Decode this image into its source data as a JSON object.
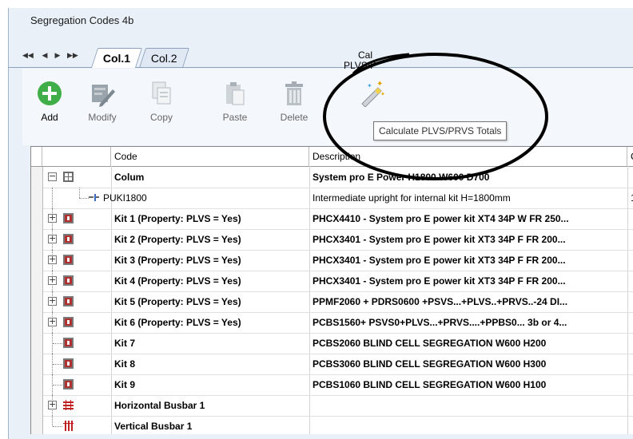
{
  "window": {
    "title": "Segregation Codes 4b"
  },
  "tabs": [
    {
      "label": "Col.1",
      "active": true
    },
    {
      "label": "Col.2",
      "active": false
    }
  ],
  "nav": {
    "first": "◀◀",
    "prev": "◀",
    "next": "▶",
    "last": "▶▶"
  },
  "toolbar": {
    "add": "Add",
    "modify": "Modify",
    "copy": "Copy",
    "paste": "Paste",
    "delete": "Delete",
    "calc_line1": "Cal",
    "calc_line2": "PLVS/P",
    "tooltip": "Calculate PLVS/PRVS Totals"
  },
  "grid": {
    "headers": {
      "code": "Code",
      "description": "Description",
      "extra": "C"
    },
    "rows": [
      {
        "code": "Colum",
        "description": "System pro E Power H1800 W600 D700",
        "bold": true,
        "extra": ""
      },
      {
        "code": "PUKI1800",
        "description": "Intermediate upright for internal kit H=1800mm",
        "bold": false,
        "extra": "1"
      },
      {
        "code": "Kit 1 (Property: PLVS = Yes)",
        "description": "PHCX4410 - System pro E power kit XT4 34P W FR 250...",
        "bold": true,
        "extra": ""
      },
      {
        "code": "Kit 2 (Property: PLVS = Yes)",
        "description": "PHCX3401 - System pro E power kit XT3 34P F FR 200...",
        "bold": true,
        "extra": ""
      },
      {
        "code": "Kit 3 (Property: PLVS = Yes)",
        "description": "PHCX3401 - System pro E power kit XT3 34P F FR 200...",
        "bold": true,
        "extra": ""
      },
      {
        "code": "Kit 4 (Property: PLVS = Yes)",
        "description": "PHCX3401 - System pro E power kit XT3 34P F FR 200...",
        "bold": true,
        "extra": ""
      },
      {
        "code": "Kit 5 (Property: PLVS = Yes)",
        "description": "PPMF2060 + PDRS0600 +PSVS...+PLVS..+PRVS..-24 DI...",
        "bold": true,
        "extra": ""
      },
      {
        "code": "Kit 6 (Property: PLVS = Yes)",
        "description": "PCBS1560+ PSVS0+PLVS...+PRVS....+PPBS0... 3b or 4...",
        "bold": true,
        "extra": ""
      },
      {
        "code": "Kit 7",
        "description": "PCBS2060 BLIND CELL SEGREGATION W600 H200",
        "bold": true,
        "extra": ""
      },
      {
        "code": "Kit 8",
        "description": "PCBS3060 BLIND CELL SEGREGATION W600 H300",
        "bold": true,
        "extra": ""
      },
      {
        "code": "Kit 9",
        "description": "PCBS1060 BLIND CELL SEGREGATION W600 H100",
        "bold": true,
        "extra": ""
      },
      {
        "code": "Horizontal Busbar 1",
        "description": "",
        "bold": true,
        "extra": ""
      },
      {
        "code": "Vertical Busbar 1",
        "description": "",
        "bold": true,
        "extra": ""
      }
    ],
    "expander_plus": "+",
    "expander_minus": "−"
  },
  "colors": {
    "add_green": "#3fae49",
    "kit_red": "#b03030",
    "busbar_red": "#c02020",
    "annotation_black": "#000000"
  },
  "icons": [
    "add-icon",
    "modify-icon",
    "copy-icon",
    "paste-icon",
    "delete-icon",
    "magic-wand-icon",
    "column-icon",
    "upright-icon",
    "kit-icon",
    "busbar-icon"
  ]
}
